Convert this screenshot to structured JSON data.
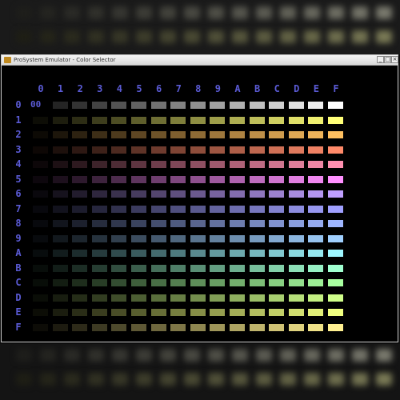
{
  "window": {
    "title": "ProSystem Emulator - Color Selector",
    "minimize_glyph": "_",
    "maximize_glyph": "□",
    "close_glyph": "×"
  },
  "selector": {
    "column_labels": [
      "0",
      "1",
      "2",
      "3",
      "4",
      "5",
      "6",
      "7",
      "8",
      "9",
      "A",
      "B",
      "C",
      "D",
      "E",
      "F"
    ],
    "row_labels": [
      "0",
      "1",
      "2",
      "3",
      "4",
      "5",
      "6",
      "7",
      "8",
      "9",
      "A",
      "B",
      "C",
      "D",
      "E",
      "F"
    ],
    "selected_value": "00",
    "selected_row": 0,
    "selected_col": 0
  },
  "palette_colors": {
    "accent_label": "#5b5bd6",
    "row_hues": [
      "#ffffff",
      "#ffff78",
      "#ffc060",
      "#ff8a6a",
      "#ff90b0",
      "#ff90ff",
      "#c0a0ff",
      "#a0a0ff",
      "#9fb6ff",
      "#a0d0ff",
      "#9ff7ff",
      "#a0ffd0",
      "#a8ffa0",
      "#d0ff8a",
      "#f0ff80",
      "#fff090"
    ]
  }
}
